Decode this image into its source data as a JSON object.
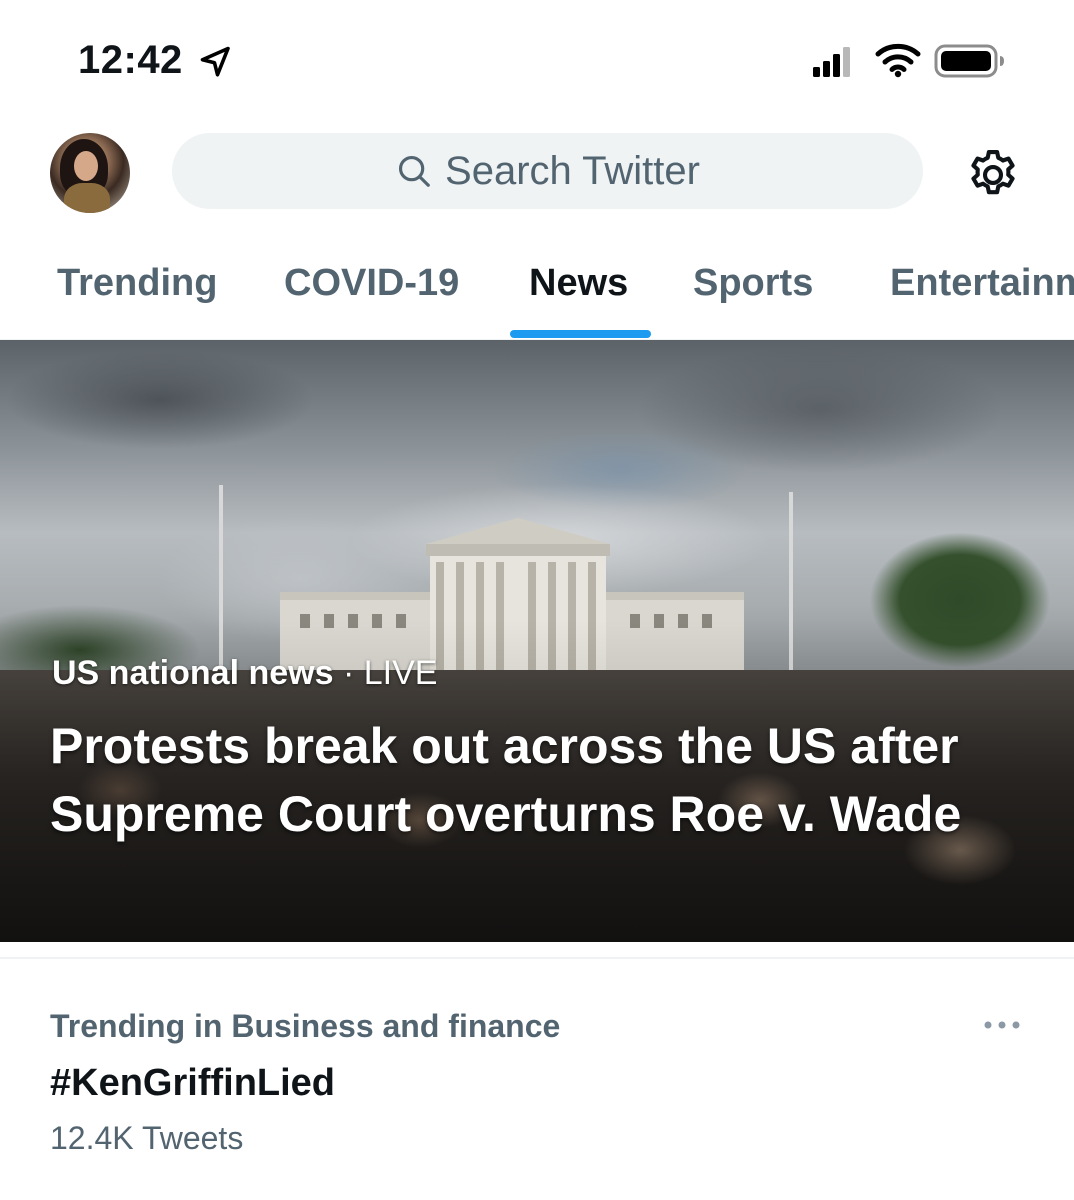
{
  "status_bar": {
    "time": "12:42",
    "icons": [
      "location-arrow-icon",
      "cellular-signal-icon",
      "wifi-icon",
      "battery-icon"
    ]
  },
  "header": {
    "avatar": "profile-avatar",
    "search": {
      "placeholder": "Search Twitter",
      "icon": "search-icon"
    },
    "settings_icon": "gear-icon"
  },
  "tabs": [
    {
      "label": "Trending",
      "active": false
    },
    {
      "label": "COVID-19",
      "active": false
    },
    {
      "label": "News",
      "active": true
    },
    {
      "label": "Sports",
      "active": false
    },
    {
      "label": "Entertainment",
      "active": false
    }
  ],
  "hero": {
    "category": "US national news",
    "separator": " · ",
    "status": "LIVE",
    "headline": "Protests break out across the US after Supreme Court overturns Roe v. Wade"
  },
  "trend": {
    "context": "Trending in Business and finance",
    "title": "#KenGriffinLied",
    "count": "12.4K Tweets",
    "more_icon": "more-dots-icon"
  },
  "colors": {
    "accent": "#1d9bf0",
    "text_primary": "#0f1419",
    "text_secondary": "#536471",
    "search_bg": "#eff3f4"
  }
}
